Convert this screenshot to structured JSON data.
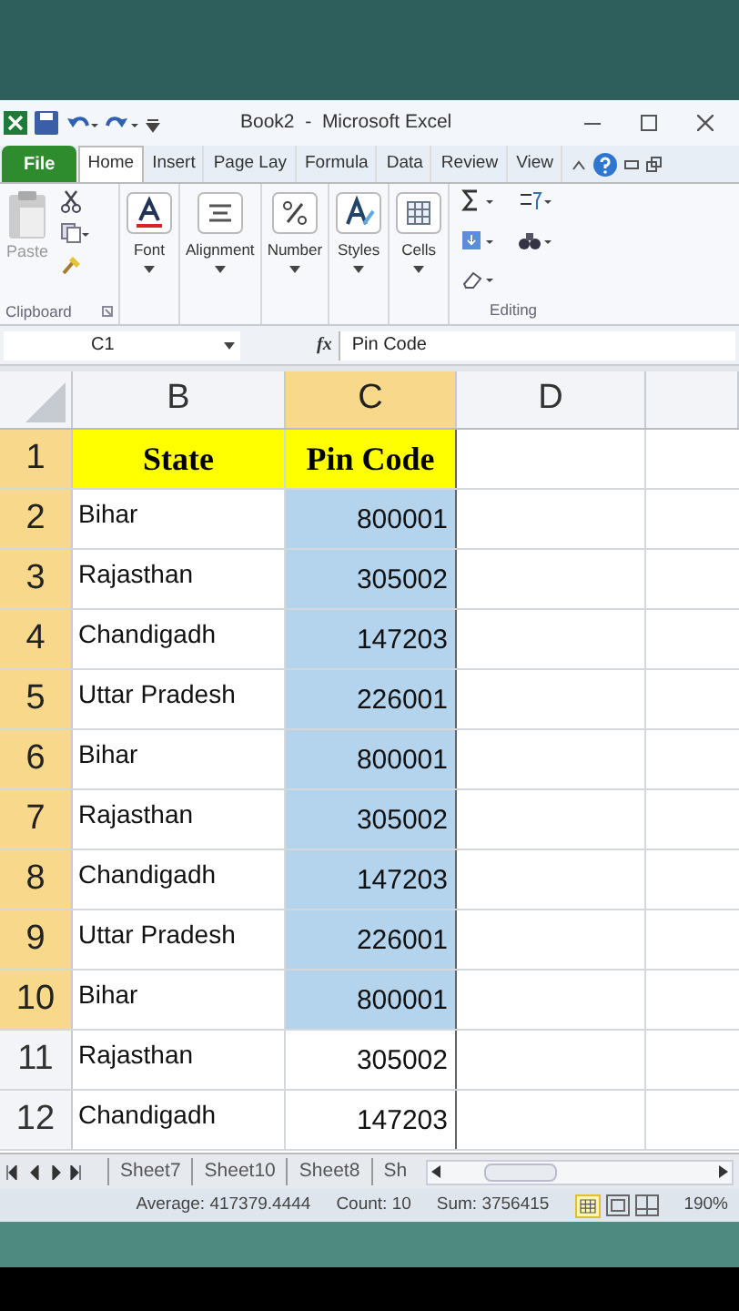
{
  "window": {
    "title": "Book2  -  Microsoft Excel"
  },
  "tabs": [
    {
      "label": "File",
      "kind": "file",
      "selected": false
    },
    {
      "label": "Home",
      "kind": "tab",
      "selected": true
    },
    {
      "label": "Insert",
      "kind": "tab",
      "selected": false
    },
    {
      "label": "Page Lay",
      "kind": "tab",
      "selected": false
    },
    {
      "label": "Formula",
      "kind": "tab",
      "selected": false
    },
    {
      "label": "Data",
      "kind": "tab",
      "selected": false
    },
    {
      "label": "Review",
      "kind": "tab",
      "selected": false
    },
    {
      "label": "View",
      "kind": "tab",
      "selected": false
    }
  ],
  "ribbon": {
    "paste": "Paste",
    "clipboard_label": "Clipboard",
    "editing_label": "Editing",
    "buttons": [
      {
        "label": "Font",
        "kind": "font"
      },
      {
        "label": "Alignment",
        "kind": "align"
      },
      {
        "label": "Number",
        "kind": "number"
      },
      {
        "label": "Styles",
        "kind": "styles"
      },
      {
        "label": "Cells",
        "kind": "cells"
      }
    ]
  },
  "formula_bar": {
    "name_box": "C1",
    "fx": "fx",
    "value": "Pin Code"
  },
  "columns": [
    {
      "label": "B",
      "selected": false
    },
    {
      "label": "C",
      "selected": true
    },
    {
      "label": "D",
      "selected": false
    }
  ],
  "rows": [
    {
      "number": "1",
      "kind": "header",
      "state": "State",
      "pin": "Pin Code",
      "selected": true
    },
    {
      "number": "2",
      "kind": "data",
      "state": "Bihar",
      "pin": "800001",
      "selected": true
    },
    {
      "number": "3",
      "kind": "data",
      "state": "Rajasthan",
      "pin": "305002",
      "selected": true
    },
    {
      "number": "4",
      "kind": "data",
      "state": "Chandigadh",
      "pin": "147203",
      "selected": true
    },
    {
      "number": "5",
      "kind": "data",
      "state": "Uttar Pradesh",
      "pin": "226001",
      "selected": true
    },
    {
      "number": "6",
      "kind": "data",
      "state": "Bihar",
      "pin": "800001",
      "selected": true
    },
    {
      "number": "7",
      "kind": "data",
      "state": "Rajasthan",
      "pin": "305002",
      "selected": true
    },
    {
      "number": "8",
      "kind": "data",
      "state": "Chandigadh",
      "pin": "147203",
      "selected": true
    },
    {
      "number": "9",
      "kind": "data",
      "state": "Uttar Pradesh",
      "pin": "226001",
      "selected": true
    },
    {
      "number": "10",
      "kind": "data",
      "state": "Bihar",
      "pin": "800001",
      "selected": true
    },
    {
      "number": "11",
      "kind": "data",
      "state": "Rajasthan",
      "pin": "305002",
      "selected": false
    },
    {
      "number": "12",
      "kind": "data",
      "state": "Chandigadh",
      "pin": "147203",
      "selected": false
    }
  ],
  "sheet_tabs": [
    "Sheet7",
    "Sheet10",
    "Sheet8",
    "Sh"
  ],
  "status_bar": {
    "average": "Average: 417379.4444",
    "count": "Count: 10",
    "sum": "Sum: 3756415",
    "zoom": "190%"
  }
}
